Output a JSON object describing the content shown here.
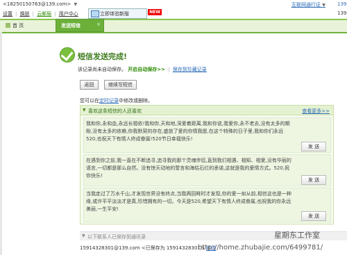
{
  "header": {
    "account": "<18250150763@139.com>",
    "links": [
      "设置",
      "换肤",
      "云邮局",
      "用户中心"
    ],
    "download_button": "立即体验新版",
    "new_badge": "NEW",
    "channel_link": "互联网通行证",
    "right_num_1": "139",
    "right_num_2": "139"
  },
  "tabs": {
    "home": "首 页",
    "active": "发送短信",
    "close": "×"
  },
  "result": {
    "title": "短信发送完成!",
    "note_prefix": "该记录尚未自动保存。",
    "note_bold": "开启自动保存>>",
    "note_sep": "|",
    "note_link": "保存到珍藏记录",
    "back_button": "返回",
    "continue_button": "继续写短信",
    "hint_prefix": "您可以在",
    "hint_link": "定时记录",
    "hint_suffix": "中修改或删除。"
  },
  "panel": {
    "header": "喜欢这条短信的人还喜欢",
    "more": "查看更多>>",
    "send_label": "发 送",
    "items": [
      "我和你,永和血,永远长相依!我和你,天和地,深爱着距离,我和你说,我爱你,永不老去,没有太多的期盼,没有太多的依赖,你我默契的存在,盛放了爱的你情我愿,在这个特殊的日子里,我和你们永远520,也祝天下有情人终成眷属!520节日幸福快乐!",
      "在遇到你之前,我一直在不断追寻,追寻我的那个灵魂伴侣,直到我们相遇、相知、相爱,没有华丽的语言,一切都是那么自然。没有惊天动地的誓言和海枯石烂的承诺,这就是我的爱情方式。520,祝你快乐!",
      "当我走过了万水千山,才发现世界没有终点,当我两回眸时才发现,你的爱一如从前,相信这也是一种缘,或许平平淡淡才是真,珍惜拥有的一切。今天是520,希望天下有情人终成眷属,也祝我的你永远美丽,一生平安!"
    ]
  },
  "saved": {
    "bar_label": "以下联系人已保存到通讯录",
    "row_email": "15914328301@139.com",
    "row_text": "<已保存为 15914328301/s",
    "row_link": "修改"
  },
  "watermark": {
    "line1": "星期东工作室",
    "line2": "http://home.zhubajie.com/6499781/"
  }
}
